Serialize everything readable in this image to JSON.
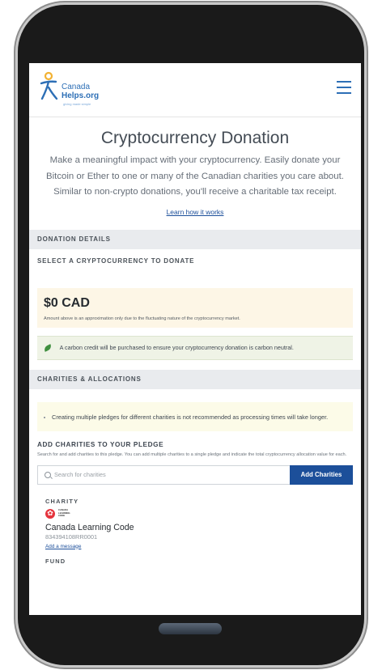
{
  "header": {
    "logo_line1": "Canada",
    "logo_line2": "Helps.org",
    "logo_tagline": "giving made simple"
  },
  "page": {
    "title": "Cryptocurrency Donation",
    "intro": "Make a meaningful impact with your cryptocurrency. Easily donate your Bitcoin or Ether to one or many of the Canadian charities you care about. Similar to non-crypto donations, you'll receive a charitable tax receipt.",
    "learn_link": "Learn how it works"
  },
  "donation_details": {
    "section_label": "DONATION DETAILS",
    "select_label": "SELECT A CRYPTOCURRENCY TO DONATE",
    "amount": "$0 CAD",
    "amount_note": "Amount above is an approximation only due to the fluctuating nature of the cryptocurrency market.",
    "carbon_note": "A carbon credit will be purchased to ensure your cryptocurrency donation is carbon neutral."
  },
  "charities": {
    "section_label": "CHARITIES & ALLOCATIONS",
    "warning": "Creating multiple pledges for different charities is not recommended as processing times will take longer.",
    "add_title": "ADD CHARITIES TO YOUR PLEDGE",
    "add_desc": "Search for and add charities to this pledge. You can add multiple charities to a single pledge and indicate the total cryptocurrency allocation value for each.",
    "search_placeholder": "Search for charities",
    "add_button": "Add Charities",
    "charity_label": "CHARITY",
    "charity_logo_text": "CANADA LEARNING CODE",
    "charity_name": "Canada Learning Code",
    "charity_number": "834394108RR0001",
    "add_message": "Add a message",
    "fund_label": "FUND"
  },
  "colors": {
    "brand_blue": "#1c4f9a",
    "band_gray": "#e9ebee",
    "amount_bg": "#fdf6e6",
    "carbon_bg": "#eff3e6",
    "warning_bg": "#fcfbe8",
    "charity_red": "#e5343d"
  }
}
